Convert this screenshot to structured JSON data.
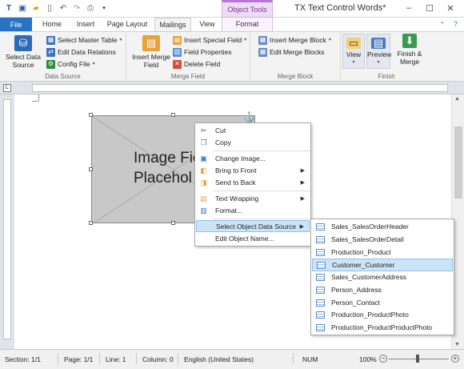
{
  "window": {
    "title": "TX Text Control Words*",
    "context_tab_group": "Object Tools"
  },
  "tabs": [
    "File",
    "Home",
    "Insert",
    "Page Layout",
    "Mailings",
    "View",
    "Format"
  ],
  "ribbon": {
    "data_source": {
      "label": "Data Source",
      "select_data_source": "Select Data\nSource",
      "select_master_table": "Select Master Table",
      "edit_data_relations": "Edit Data Relations",
      "config_file": "Config File"
    },
    "merge_field": {
      "label": "Merge Field",
      "insert_merge_field": "Insert Merge\nField",
      "insert_special_field": "Insert Special Field",
      "field_properties": "Field Properties",
      "delete_field": "Delete Field"
    },
    "merge_block": {
      "label": "Merge Block",
      "insert_merge_block": "Insert Merge Block",
      "edit_merge_blocks": "Edit Merge Blocks"
    },
    "finish": {
      "label": "Finish",
      "view": "View",
      "preview": "Preview",
      "finish_merge": "Finish &\nMerge"
    }
  },
  "document": {
    "image_placeholder_text": "Image Fie\nPlacehol",
    "ruler_tab_marker": "L"
  },
  "context_menu": {
    "items": [
      "Cut",
      "Copy",
      "Change Image...",
      "Bring to Front",
      "Send to Back",
      "Text Wrapping",
      "Format...",
      "Select Object Data Source",
      "Edit Object Name..."
    ]
  },
  "submenu": {
    "items": [
      "Sales_SalesOrderHeader",
      "Sales_SalesOrderDetail",
      "Production_Product",
      "Customer_Customer",
      "Sales_CustomerAddress",
      "Person_Address",
      "Person_Contact",
      "Production_ProductPhoto",
      "Production_ProductProductPhoto"
    ],
    "selected": "Customer_Customer"
  },
  "status": {
    "section": "Section: 1/1",
    "page": "Page: 1/1",
    "line": "Line: 1",
    "column": "Column: 0",
    "language": "English (United States)",
    "num": "NUM",
    "zoom": "100%"
  },
  "colors": {
    "file_tab": "#2a72c4",
    "context_tab": "#b877d3",
    "highlight": "#cce4f7"
  }
}
